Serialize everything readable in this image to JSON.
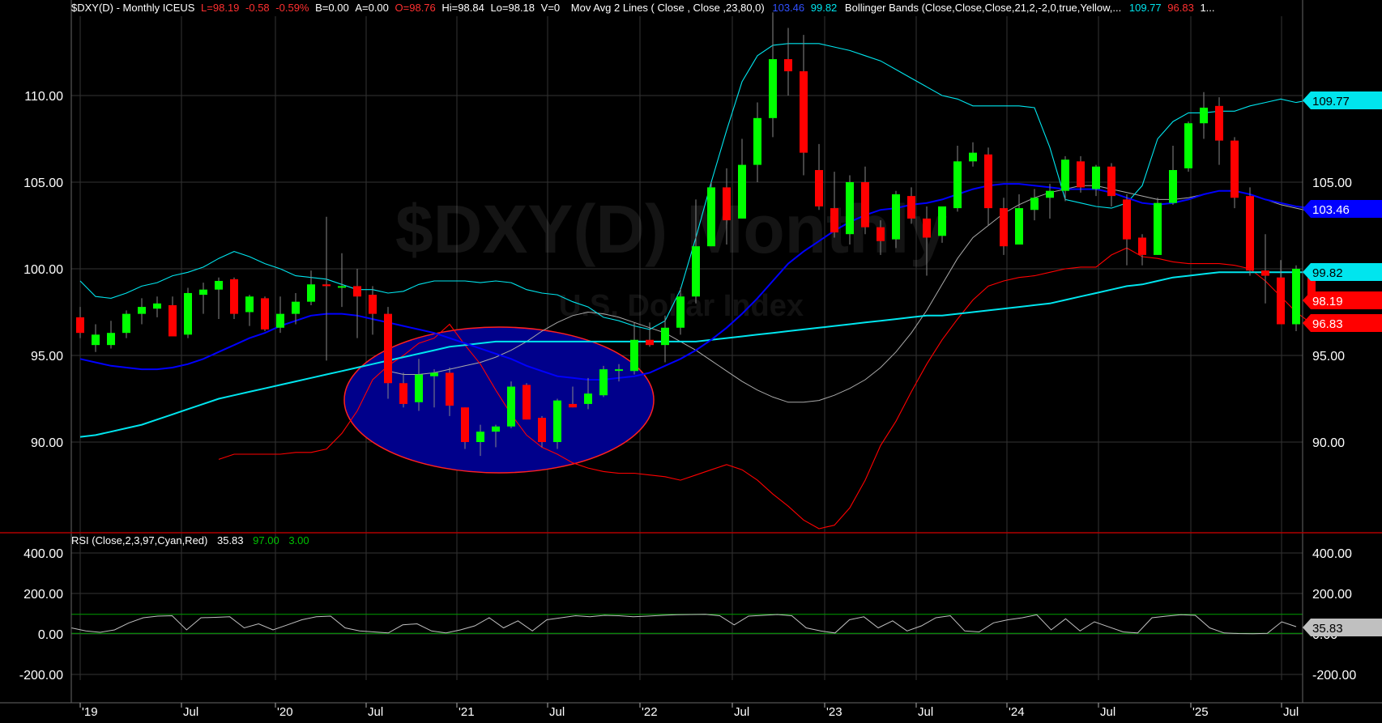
{
  "header": {
    "symbol": "$DXY(D) - Monthly  ICEUS",
    "last": "L=98.19",
    "change": "-0.58",
    "change_pct": "-0.59%",
    "bid": "B=0.00",
    "ask": "A=0.00",
    "open": "O=98.76",
    "high": "Hi=98.84",
    "low": "Lo=98.18",
    "volume": "V=0",
    "ma_study": "Mov Avg 2 Lines ( Close , Close ,23,80,0)",
    "ma_v1": "103.46",
    "ma_v2": "99.82",
    "bb_study": "Bollinger Bands (Close,Close,Close,21,2,-2,0,true,Yellow,...",
    "bb_upper": "109.77",
    "bb_lower": "96.83",
    "bb_more": "1..."
  },
  "watermark": {
    "symbol": "$DXY(D) Monthly",
    "name": "U.S. Dollar Index"
  },
  "rsi_header": {
    "study": "RSI (Close,2,3,97,Cyan,Red)",
    "value": "35.83",
    "overbought": "97.00",
    "oversold": "3.00"
  },
  "price_axis": {
    "left_ticks": [
      "110.00",
      "105.00",
      "100.00",
      "95.00",
      "90.00"
    ],
    "right_ticks": [
      "105.00",
      "95.00",
      "90.00"
    ]
  },
  "rsi_axis": {
    "ticks": [
      "400.00",
      "200.00",
      "0.00",
      "-200.00"
    ]
  },
  "tags": [
    {
      "label": "109.77",
      "color": "#00e5ee"
    },
    {
      "label": "103.46",
      "color": "#0000ff"
    },
    {
      "label": "99.82",
      "color": "#00e5ee"
    },
    {
      "label": "98.19",
      "color": "#ff0000"
    },
    {
      "label": "96.83",
      "color": "#ff0000"
    },
    {
      "label": "35.83",
      "color": "#c0c0c0"
    }
  ],
  "colors": {
    "up": "#00ff00",
    "down": "#ff0000",
    "ma_fast": "#0000ff",
    "ma_slow": "#00e5ee",
    "bb_upper": "#00e5ee",
    "bb_lower": "#ff0000",
    "bb_mid": "#a9a9a9",
    "ellipse_fill": "#00008b",
    "rsi_line": "#c0c0c0",
    "rsi_bands": "#00a000"
  },
  "chart_data": {
    "type": "candlestick",
    "title": "$DXY(D) - Monthly ICEUS",
    "x_labels": [
      "'19",
      "Jul",
      "'20",
      "Jul",
      "'21",
      "Jul",
      "'22",
      "Jul",
      "'23",
      "Jul",
      "'24",
      "Jul",
      "'25",
      "Jul"
    ],
    "ylim": [
      85.0,
      115.5
    ],
    "candles": [
      {
        "o": 97.2,
        "h": 97.8,
        "l": 96.0,
        "c": 96.3
      },
      {
        "o": 95.6,
        "h": 96.8,
        "l": 95.2,
        "c": 96.2
      },
      {
        "o": 95.6,
        "h": 97.0,
        "l": 95.4,
        "c": 96.3
      },
      {
        "o": 96.3,
        "h": 97.6,
        "l": 96.0,
        "c": 97.4
      },
      {
        "o": 97.4,
        "h": 98.3,
        "l": 96.8,
        "c": 97.8
      },
      {
        "o": 97.7,
        "h": 98.4,
        "l": 97.2,
        "c": 98.0
      },
      {
        "o": 97.9,
        "h": 98.4,
        "l": 96.6,
        "c": 96.1
      },
      {
        "o": 96.2,
        "h": 98.9,
        "l": 96.0,
        "c": 98.6
      },
      {
        "o": 98.5,
        "h": 99.2,
        "l": 97.4,
        "c": 98.8
      },
      {
        "o": 98.8,
        "h": 99.5,
        "l": 97.1,
        "c": 99.3
      },
      {
        "o": 99.4,
        "h": 99.5,
        "l": 97.1,
        "c": 97.4
      },
      {
        "o": 97.5,
        "h": 98.5,
        "l": 96.7,
        "c": 98.4
      },
      {
        "o": 98.3,
        "h": 98.4,
        "l": 96.4,
        "c": 96.5
      },
      {
        "o": 96.6,
        "h": 98.4,
        "l": 96.3,
        "c": 97.4
      },
      {
        "o": 97.4,
        "h": 98.6,
        "l": 96.8,
        "c": 98.1
      },
      {
        "o": 98.1,
        "h": 99.9,
        "l": 97.9,
        "c": 99.1
      },
      {
        "o": 99.1,
        "h": 103.0,
        "l": 94.7,
        "c": 99.0
      },
      {
        "o": 99.0,
        "h": 100.9,
        "l": 97.8,
        "c": 99.0
      },
      {
        "o": 99.0,
        "h": 100.0,
        "l": 96.0,
        "c": 98.4
      },
      {
        "o": 98.5,
        "h": 99.0,
        "l": 96.2,
        "c": 97.4
      },
      {
        "o": 97.4,
        "h": 97.8,
        "l": 92.5,
        "c": 93.4
      },
      {
        "o": 93.4,
        "h": 94.0,
        "l": 92.0,
        "c": 92.2
      },
      {
        "o": 92.3,
        "h": 94.8,
        "l": 91.8,
        "c": 93.9
      },
      {
        "o": 93.8,
        "h": 94.2,
        "l": 92.0,
        "c": 94.0
      },
      {
        "o": 94.0,
        "h": 94.3,
        "l": 91.5,
        "c": 92.1
      },
      {
        "o": 92.0,
        "h": 92.0,
        "l": 89.6,
        "c": 90.0
      },
      {
        "o": 90.0,
        "h": 91.0,
        "l": 89.2,
        "c": 90.6
      },
      {
        "o": 90.6,
        "h": 91.0,
        "l": 89.7,
        "c": 90.9
      },
      {
        "o": 90.9,
        "h": 93.5,
        "l": 90.8,
        "c": 93.2
      },
      {
        "o": 93.3,
        "h": 93.4,
        "l": 91.3,
        "c": 91.3
      },
      {
        "o": 91.4,
        "h": 91.5,
        "l": 89.7,
        "c": 90.0
      },
      {
        "o": 90.0,
        "h": 92.5,
        "l": 89.6,
        "c": 92.4
      },
      {
        "o": 92.2,
        "h": 93.2,
        "l": 92.0,
        "c": 92.0
      },
      {
        "o": 92.2,
        "h": 93.7,
        "l": 91.9,
        "c": 92.8
      },
      {
        "o": 92.7,
        "h": 94.4,
        "l": 92.6,
        "c": 94.2
      },
      {
        "o": 94.2,
        "h": 94.5,
        "l": 93.5,
        "c": 94.2
      },
      {
        "o": 94.1,
        "h": 96.9,
        "l": 93.9,
        "c": 95.9
      },
      {
        "o": 95.9,
        "h": 96.9,
        "l": 95.5,
        "c": 95.6
      },
      {
        "o": 95.6,
        "h": 97.3,
        "l": 94.6,
        "c": 96.6
      },
      {
        "o": 96.6,
        "h": 98.9,
        "l": 96.2,
        "c": 98.4
      },
      {
        "o": 98.4,
        "h": 104.0,
        "l": 98.0,
        "c": 101.3
      },
      {
        "o": 101.3,
        "h": 105.0,
        "l": 101.3,
        "c": 104.7
      },
      {
        "o": 104.7,
        "h": 105.8,
        "l": 101.4,
        "c": 102.8
      },
      {
        "o": 102.9,
        "h": 107.5,
        "l": 102.9,
        "c": 106.0
      },
      {
        "o": 106.0,
        "h": 109.6,
        "l": 105.0,
        "c": 108.7
      },
      {
        "o": 108.7,
        "h": 114.8,
        "l": 107.6,
        "c": 112.1
      },
      {
        "o": 112.1,
        "h": 113.9,
        "l": 110.0,
        "c": 111.4
      },
      {
        "o": 111.4,
        "h": 113.5,
        "l": 105.4,
        "c": 106.7
      },
      {
        "o": 105.7,
        "h": 107.2,
        "l": 103.4,
        "c": 103.6
      },
      {
        "o": 103.5,
        "h": 105.6,
        "l": 101.8,
        "c": 102.1
      },
      {
        "o": 102.0,
        "h": 105.4,
        "l": 101.4,
        "c": 105.0
      },
      {
        "o": 105.0,
        "h": 105.9,
        "l": 102.0,
        "c": 102.4
      },
      {
        "o": 102.4,
        "h": 102.8,
        "l": 100.8,
        "c": 101.6
      },
      {
        "o": 101.7,
        "h": 104.5,
        "l": 101.2,
        "c": 104.3
      },
      {
        "o": 104.2,
        "h": 104.7,
        "l": 102.6,
        "c": 102.9
      },
      {
        "o": 102.9,
        "h": 103.6,
        "l": 99.6,
        "c": 101.8
      },
      {
        "o": 101.9,
        "h": 103.6,
        "l": 101.5,
        "c": 103.6
      },
      {
        "o": 103.5,
        "h": 107.1,
        "l": 103.3,
        "c": 106.2
      },
      {
        "o": 106.2,
        "h": 107.3,
        "l": 105.9,
        "c": 106.7
      },
      {
        "o": 106.6,
        "h": 107.0,
        "l": 102.5,
        "c": 103.5
      },
      {
        "o": 103.5,
        "h": 104.1,
        "l": 100.8,
        "c": 101.3
      },
      {
        "o": 101.4,
        "h": 104.3,
        "l": 101.4,
        "c": 103.5
      },
      {
        "o": 103.4,
        "h": 104.6,
        "l": 102.8,
        "c": 104.1
      },
      {
        "o": 104.1,
        "h": 104.9,
        "l": 102.9,
        "c": 104.5
      },
      {
        "o": 104.5,
        "h": 106.5,
        "l": 103.9,
        "c": 106.3
      },
      {
        "o": 106.2,
        "h": 106.5,
        "l": 104.4,
        "c": 104.7
      },
      {
        "o": 104.6,
        "h": 106.0,
        "l": 104.2,
        "c": 105.9
      },
      {
        "o": 105.9,
        "h": 106.1,
        "l": 103.6,
        "c": 104.2
      },
      {
        "o": 104.0,
        "h": 104.3,
        "l": 100.2,
        "c": 101.7
      },
      {
        "o": 101.8,
        "h": 102.0,
        "l": 100.2,
        "c": 100.8
      },
      {
        "o": 100.8,
        "h": 104.1,
        "l": 100.8,
        "c": 103.8
      },
      {
        "o": 103.8,
        "h": 107.1,
        "l": 103.7,
        "c": 105.7
      },
      {
        "o": 105.8,
        "h": 108.5,
        "l": 105.6,
        "c": 108.4
      },
      {
        "o": 108.4,
        "h": 110.2,
        "l": 107.5,
        "c": 109.3
      },
      {
        "o": 109.4,
        "h": 109.9,
        "l": 106.0,
        "c": 107.4
      },
      {
        "o": 107.4,
        "h": 107.6,
        "l": 103.5,
        "c": 104.1
      },
      {
        "o": 104.2,
        "h": 104.7,
        "l": 99.6,
        "c": 99.9
      },
      {
        "o": 99.9,
        "h": 102.0,
        "l": 98.0,
        "c": 99.6
      },
      {
        "o": 99.5,
        "h": 100.5,
        "l": 97.6,
        "c": 96.8
      },
      {
        "o": 96.8,
        "h": 100.2,
        "l": 96.4,
        "c": 100.0
      },
      {
        "o": 100.0,
        "h": 100.3,
        "l": 98.0,
        "c": 98.2
      }
    ],
    "ma_23": [
      94.8,
      94.6,
      94.4,
      94.3,
      94.2,
      94.2,
      94.3,
      94.5,
      94.8,
      95.2,
      95.6,
      96.0,
      96.3,
      96.7,
      97.0,
      97.3,
      97.4,
      97.4,
      97.3,
      97.1,
      96.9,
      96.7,
      96.5,
      96.3,
      96.0,
      95.7,
      95.4,
      95.1,
      94.8,
      94.4,
      94.1,
      93.8,
      93.7,
      93.6,
      93.6,
      93.7,
      93.8,
      94.0,
      94.4,
      94.8,
      95.3,
      95.9,
      96.6,
      97.4,
      98.3,
      99.3,
      100.3,
      101.0,
      101.6,
      102.2,
      102.7,
      103.1,
      103.4,
      103.5,
      103.7,
      103.8,
      104.0,
      104.3,
      104.6,
      104.8,
      104.9,
      104.9,
      104.8,
      104.7,
      104.6,
      104.6,
      104.6,
      104.4,
      104.1,
      103.8,
      103.7,
      103.8,
      104.0,
      104.3,
      104.5,
      104.5,
      104.3,
      104.0,
      103.8,
      103.6,
      103.5
    ],
    "ma_80": [
      90.3,
      90.4,
      90.6,
      90.8,
      91.0,
      91.3,
      91.6,
      91.9,
      92.2,
      92.5,
      92.7,
      92.9,
      93.1,
      93.3,
      93.5,
      93.7,
      93.9,
      94.1,
      94.3,
      94.5,
      94.7,
      94.9,
      95.1,
      95.3,
      95.5,
      95.6,
      95.7,
      95.8,
      95.8,
      95.8,
      95.8,
      95.8,
      95.8,
      95.8,
      95.8,
      95.8,
      95.8,
      95.8,
      95.8,
      95.8,
      95.8,
      95.9,
      96.0,
      96.1,
      96.2,
      96.3,
      96.4,
      96.5,
      96.6,
      96.7,
      96.8,
      96.9,
      97.0,
      97.1,
      97.2,
      97.3,
      97.3,
      97.4,
      97.5,
      97.6,
      97.7,
      97.8,
      97.9,
      98.0,
      98.2,
      98.4,
      98.6,
      98.8,
      99.0,
      99.1,
      99.3,
      99.5,
      99.6,
      99.7,
      99.8,
      99.8,
      99.8,
      99.8,
      99.8,
      99.8,
      99.8
    ],
    "bb_upper": [
      99.3,
      98.4,
      98.3,
      98.6,
      99.0,
      99.2,
      99.6,
      99.8,
      100.1,
      100.6,
      101.0,
      100.7,
      100.3,
      100.0,
      99.6,
      99.5,
      99.4,
      99.1,
      98.8,
      98.8,
      98.6,
      98.7,
      99.1,
      99.3,
      99.3,
      99.3,
      99.2,
      99.3,
      99.2,
      98.8,
      98.6,
      98.5,
      98.1,
      97.8,
      97.2,
      97.0,
      96.7,
      96.5,
      97.0,
      98.8,
      101.8,
      105.0,
      108.0,
      110.8,
      112.3,
      112.9,
      113.0,
      113.0,
      113.0,
      112.8,
      112.6,
      112.3,
      112.0,
      111.5,
      111.0,
      110.5,
      110.0,
      109.8,
      109.4,
      109.4,
      109.4,
      109.4,
      109.3,
      107.0,
      104.0,
      103.8,
      103.6,
      103.5,
      103.8,
      104.8,
      107.5,
      108.5,
      109.0,
      109.0,
      109.1,
      109.1,
      109.4,
      109.6,
      109.8,
      109.6,
      109.77
    ],
    "bb_lower": [
      89.0,
      89.3,
      89.3,
      89.3,
      89.3,
      89.4,
      89.4,
      89.6,
      90.5,
      91.8,
      93.6,
      94.4,
      95.0,
      95.7,
      96.0,
      96.8,
      95.6,
      94.5,
      93.0,
      91.6,
      90.4,
      89.7,
      89.3,
      88.8,
      88.5,
      88.3,
      88.2,
      88.2,
      88.1,
      88.0,
      87.8,
      88.1,
      88.4,
      88.7,
      88.4,
      87.8,
      87.0,
      86.3,
      85.5,
      85.0,
      85.2,
      86.2,
      87.8,
      89.8,
      91.2,
      92.9,
      94.5,
      95.9,
      97.1,
      98.2,
      99.0,
      99.3,
      99.5,
      99.6,
      99.8,
      100.0,
      100.1,
      100.1,
      100.8,
      101.2,
      100.7,
      100.6,
      100.4,
      100.3,
      100.3,
      100.3,
      100.2,
      100.0,
      99.3,
      98.4,
      97.5,
      96.83
    ],
    "bb_middle": [
      94.1,
      93.9,
      93.9,
      94.0,
      94.2,
      94.4,
      94.6,
      94.9,
      95.3,
      95.8,
      96.4,
      96.9,
      97.3,
      97.5,
      97.4,
      97.2,
      96.9,
      96.6,
      96.3,
      95.8,
      95.3,
      94.7,
      94.1,
      93.5,
      93.0,
      92.6,
      92.3,
      92.3,
      92.4,
      92.7,
      93.1,
      93.6,
      94.3,
      95.2,
      96.3,
      97.6,
      99.1,
      100.6,
      101.8,
      102.5,
      103.2,
      103.7,
      104.1,
      104.4,
      104.6,
      104.8,
      104.8,
      104.6,
      104.4,
      104.2,
      104.0,
      104.0,
      104.1,
      104.3,
      104.5,
      104.5,
      104.3,
      104.0,
      103.7,
      103.5,
      103.3
    ],
    "rsi": [
      30,
      15,
      8,
      20,
      55,
      80,
      88,
      90,
      20,
      80,
      82,
      85,
      30,
      50,
      20,
      45,
      70,
      85,
      88,
      30,
      15,
      10,
      5,
      45,
      50,
      15,
      5,
      20,
      40,
      80,
      30,
      65,
      15,
      70,
      80,
      90,
      85,
      92,
      90,
      85,
      88,
      92,
      95,
      96,
      97,
      90,
      45,
      88,
      92,
      96,
      90,
      30,
      15,
      5,
      70,
      85,
      30,
      65,
      15,
      40,
      80,
      90,
      15,
      10,
      55,
      70,
      80,
      95,
      20,
      75,
      15,
      60,
      35,
      10,
      5,
      80,
      88,
      95,
      92,
      30,
      5,
      2,
      1,
      3,
      60,
      35.83
    ]
  }
}
